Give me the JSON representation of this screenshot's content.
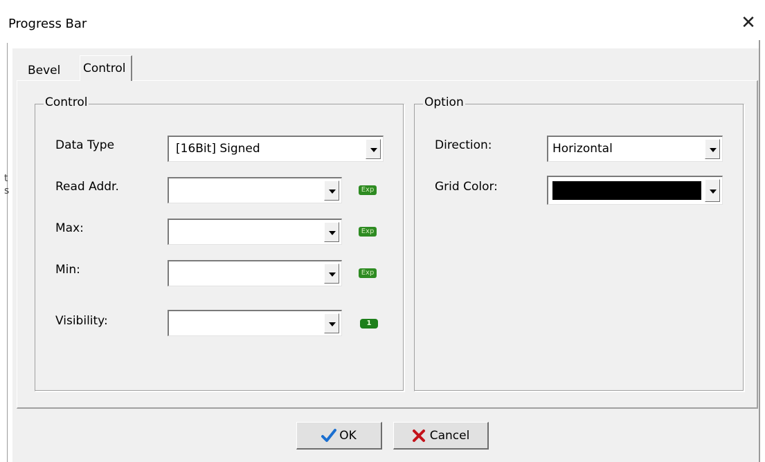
{
  "window": {
    "title": "Progress Bar",
    "close_glyph": "✕"
  },
  "tabs": [
    {
      "label": "Bevel"
    },
    {
      "label": "Control",
      "active": true
    }
  ],
  "control_group": {
    "legend": "Control",
    "data_type": {
      "label": "Data Type",
      "value": "[16Bit] Signed"
    },
    "read_addr": {
      "label": "Read Addr.",
      "value": "",
      "icon_text": "Exp"
    },
    "max": {
      "label": "Max:",
      "value": "",
      "icon_text": "Exp"
    },
    "min": {
      "label": "Min:",
      "value": "",
      "icon_text": "Exp"
    },
    "visibility": {
      "label": "Visibility:",
      "value": "",
      "icon_text": "1"
    }
  },
  "option_group": {
    "legend": "Option",
    "direction": {
      "label": "Direction:",
      "value": "Horizontal"
    },
    "grid_color": {
      "label": "Grid Color:",
      "color": "#000000"
    }
  },
  "buttons": {
    "ok_label": "OK",
    "cancel_label": "Cancel"
  },
  "icons": {
    "ok": "check-icon",
    "cancel": "x-icon",
    "expression": "exp-icon",
    "one": "one-icon"
  },
  "colors": {
    "dialog_bg": "#f0f0f0",
    "exp_green": "#2e8b22",
    "check_blue": "#1a6fd0",
    "cancel_red": "#c4121a"
  }
}
